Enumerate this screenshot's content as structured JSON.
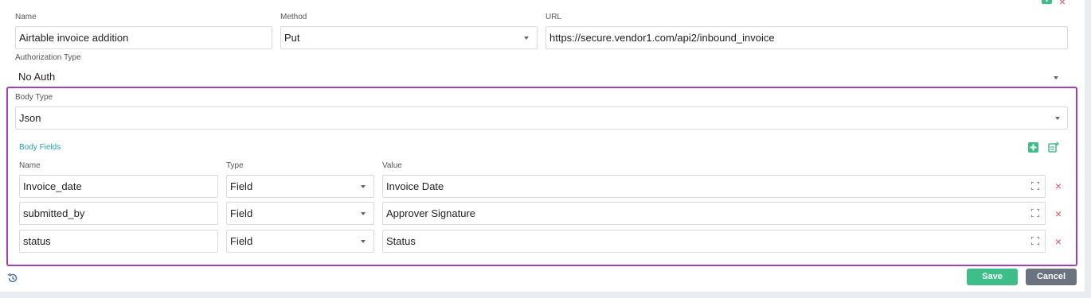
{
  "top": {
    "name_label": "Name",
    "name_value": "Airtable invoice addition",
    "method_label": "Method",
    "method_value": "Put",
    "url_label": "URL",
    "url_value": "https://secure.vendor1.com/api2/inbound_invoice",
    "auth_label": "Authorization Type",
    "auth_value": "No Auth"
  },
  "body": {
    "type_label": "Body Type",
    "type_value": "Json",
    "fields_title": "Body Fields",
    "col_name": "Name",
    "col_type": "Type",
    "col_value": "Value",
    "rows": [
      {
        "name": "Invoice_date",
        "type": "Field",
        "value": "Invoice Date"
      },
      {
        "name": "submitted_by",
        "type": "Field",
        "value": "Approver Signature"
      },
      {
        "name": "status",
        "type": "Field",
        "value": "Status"
      }
    ]
  },
  "footer": {
    "save_label": "Save",
    "cancel_label": "Cancel"
  },
  "colors": {
    "accent_purple": "#a13fb9",
    "save_green": "#3dbd87",
    "cancel_gray": "#6b7380",
    "delete_red": "#e0505c",
    "link_teal": "#2a9bb9"
  },
  "icons": [
    "add-icon",
    "close-icon",
    "chevron-down-icon",
    "add-row-icon",
    "import-fields-icon",
    "expand-icon",
    "delete-icon",
    "history-icon"
  ]
}
